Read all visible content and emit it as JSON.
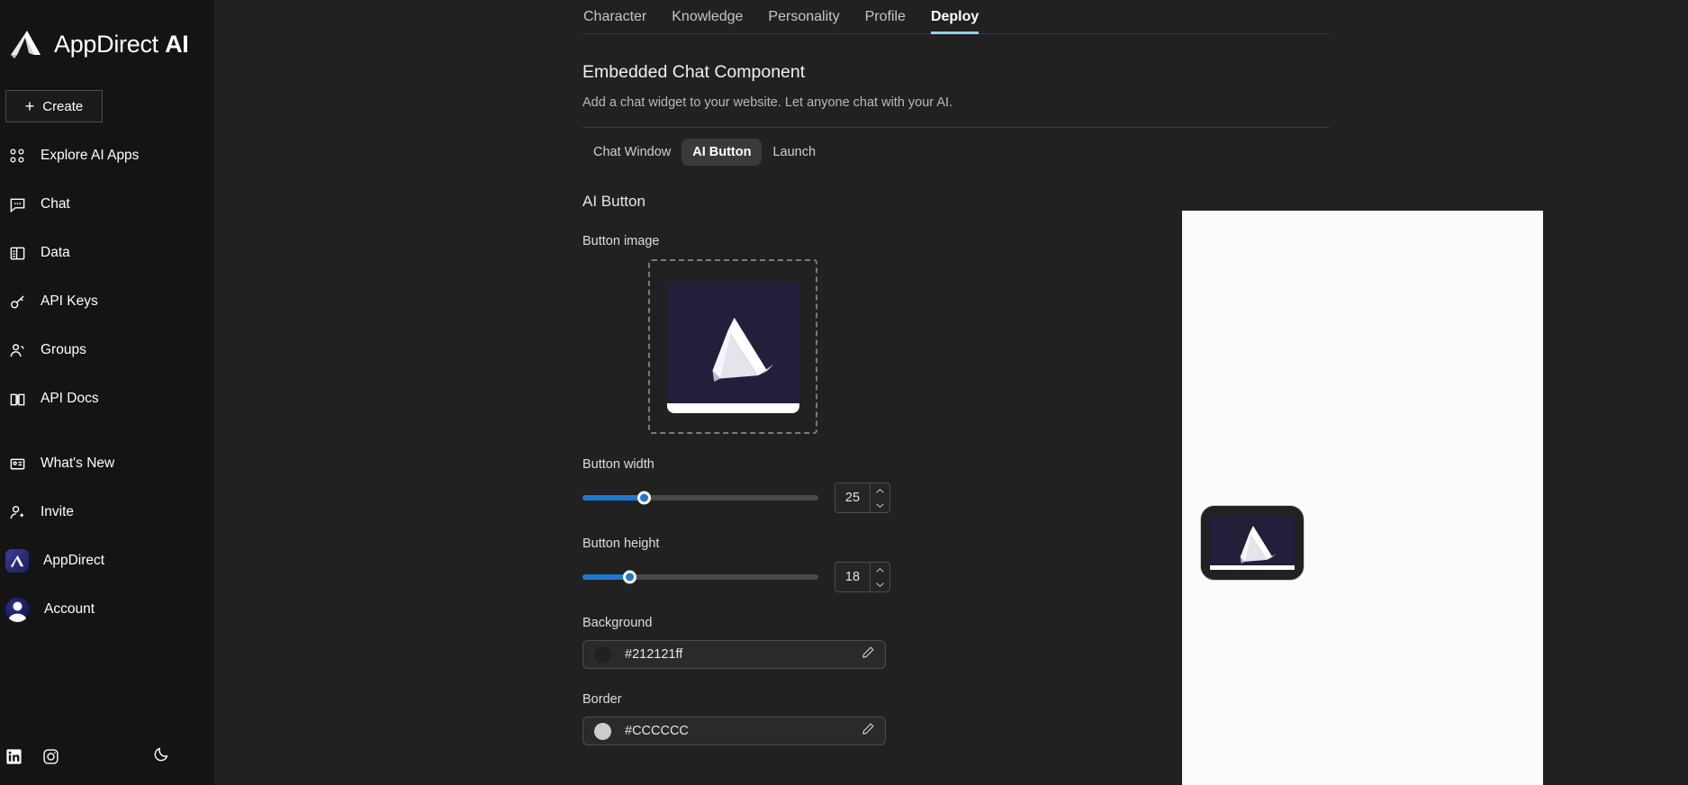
{
  "brand": {
    "name_light": "AppDirect",
    "name_bold": "AI",
    "logo_icon": "appdirect-logo-icon"
  },
  "sidebar": {
    "create_label": "Create",
    "create_icon": "plus-icon",
    "items": [
      {
        "label": "Explore AI Apps",
        "icon": "grid-apps-icon"
      },
      {
        "label": "Chat",
        "icon": "chat-bubble-icon"
      },
      {
        "label": "Data",
        "icon": "database-table-icon"
      },
      {
        "label": "API Keys",
        "icon": "key-icon"
      },
      {
        "label": "Groups",
        "icon": "users-icon"
      },
      {
        "label": "API Docs",
        "icon": "book-icon"
      }
    ],
    "lower_items": [
      {
        "label": "What's New",
        "icon": "news-card-icon"
      },
      {
        "label": "Invite",
        "icon": "user-plus-icon"
      },
      {
        "label": "AppDirect",
        "icon": "appdirect-tile-icon"
      },
      {
        "label": "Account",
        "icon": "avatar-icon"
      }
    ],
    "social": [
      {
        "name": "linkedin-icon"
      },
      {
        "name": "instagram-icon"
      }
    ],
    "theme_toggle_icon": "moon-icon"
  },
  "tabs": [
    {
      "label": "Character",
      "active": false
    },
    {
      "label": "Knowledge",
      "active": false
    },
    {
      "label": "Personality",
      "active": false
    },
    {
      "label": "Profile",
      "active": false
    },
    {
      "label": "Deploy",
      "active": true
    }
  ],
  "section": {
    "title": "Embedded Chat Component",
    "subtitle": "Add a chat widget to your website. Let anyone chat with your AI."
  },
  "subtabs": [
    {
      "label": "Chat Window",
      "active": false
    },
    {
      "label": "AI Button",
      "active": true
    },
    {
      "label": "Launch",
      "active": false
    }
  ],
  "panel": {
    "title": "AI Button",
    "button_image_label": "Button image",
    "width": {
      "label": "Button width",
      "value": "25",
      "percent": 26
    },
    "height": {
      "label": "Button height",
      "value": "18",
      "percent": 20
    },
    "background": {
      "label": "Background",
      "value": "#212121ff",
      "swatch_color": "#212121",
      "edit_icon": "pencil-icon"
    },
    "border": {
      "label": "Border",
      "value": "#CCCCCC",
      "swatch_color": "#cccccc",
      "edit_icon": "pencil-icon"
    }
  },
  "colors": {
    "accent_slider": "#1f77d0",
    "active_tab_underline": "#8fd3ec",
    "sidebar_bg": "#141414",
    "main_bg": "#212121",
    "preview_bg": "#fbfbfb",
    "logo_tile_bg": "#221f3a"
  }
}
